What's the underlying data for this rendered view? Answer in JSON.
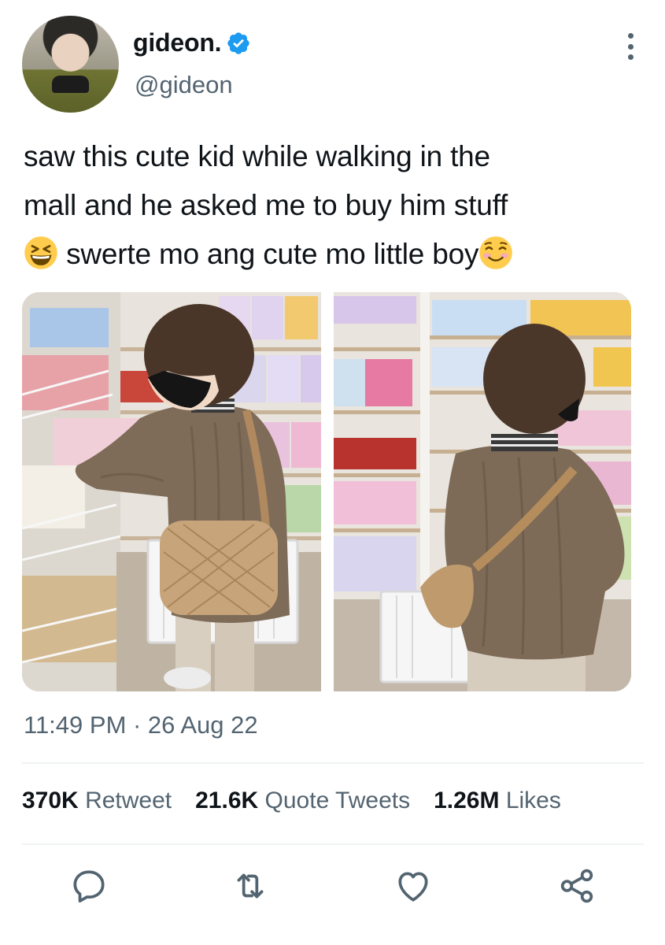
{
  "tweet": {
    "author": {
      "display_name": "gideon.",
      "handle": "@gideon",
      "verified": true,
      "verified_color": "#1d9bf0"
    },
    "text_lines": [
      "saw this cute kid while walking in the",
      "mall and he asked me to buy him stuff",
      "swerte mo ang cute mo little boy"
    ],
    "emojis": [
      "grinning-squinting-face-emoji",
      "smiling-face-emoji"
    ],
    "timestamp": "11:49 PM · 26 Aug 22",
    "stats": {
      "retweets": {
        "count": "370K",
        "label": "Retweet"
      },
      "quotes": {
        "count": "21.6K",
        "label": "Quote Tweets"
      },
      "likes": {
        "count": "1.26M",
        "label": "Likes"
      }
    },
    "actions": [
      "reply-icon",
      "retweet-icon",
      "like-icon",
      "share-icon"
    ]
  },
  "colors": {
    "text": "#0f1419",
    "secondary": "#536471",
    "divider": "#eff3f4"
  }
}
